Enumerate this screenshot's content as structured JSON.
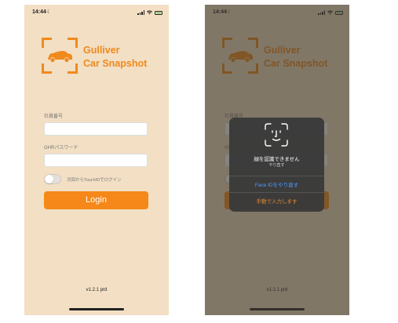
{
  "status_bar": {
    "time": "14:44",
    "moon": "☾"
  },
  "app": {
    "logo_line1": "Gulliver",
    "logo_line2": "Car Snapshot",
    "employee_label": "社員番号",
    "password_label": "GHRパスワード",
    "touchid_label": "次回からTouchIDでログイン",
    "login_button": "Login",
    "version": "v1.2.1 prd"
  },
  "faceid_dialog": {
    "title": "顔を認識できません",
    "subtitle": "やり直す",
    "retry_button": "Face IDをやり直す",
    "manual_button": "手動で入力します"
  },
  "colors": {
    "background": "#f2dfc4",
    "accent": "#f08a1c",
    "button": "#f58818"
  }
}
